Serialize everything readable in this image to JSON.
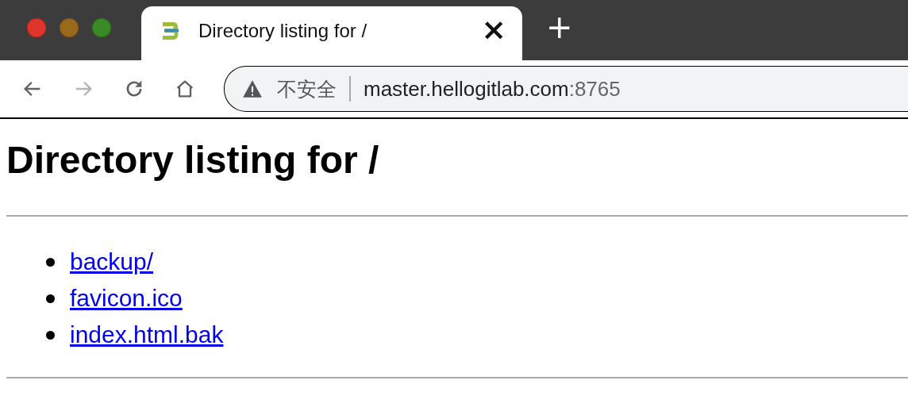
{
  "window": {
    "controls": [
      {
        "kind": "close",
        "color": "#e0352b"
      },
      {
        "kind": "minimize",
        "color": "#9a6a1c"
      },
      {
        "kind": "maximize",
        "color": "#3a8a26"
      }
    ]
  },
  "tabs": [
    {
      "title": "Directory listing for /",
      "selected": true,
      "close": "×"
    }
  ],
  "new_tab": "+",
  "toolbar": {
    "back": {
      "disabled": false
    },
    "forward": {
      "disabled": true
    },
    "security_label": "不安全",
    "url_host": "master.hellogitlab.com",
    "url_port": ":8765"
  },
  "page": {
    "heading": "Directory listing for /",
    "links": [
      {
        "text": "backup/"
      },
      {
        "text": "favicon.ico"
      },
      {
        "text": "index.html.bak"
      }
    ]
  }
}
